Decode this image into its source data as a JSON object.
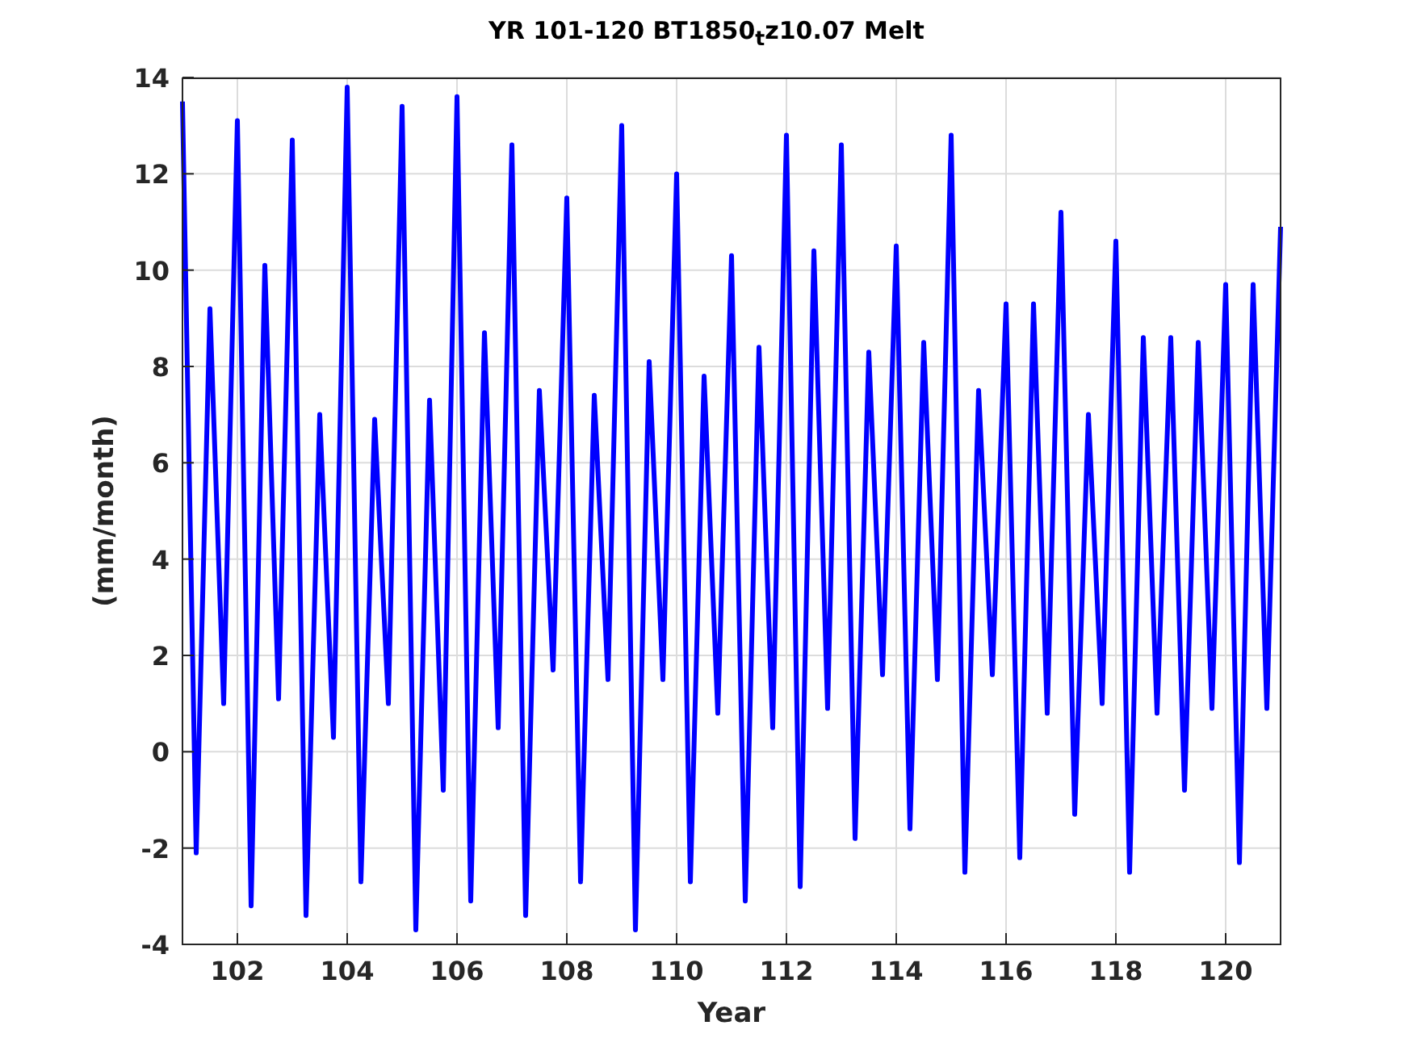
{
  "figure": {
    "chart_data": {
      "type": "line",
      "title": "YR 101-120 BT1850$_{t}$z10.07 Melt",
      "xlabel": "Year",
      "ylabel": "(mm/month)",
      "x": [
        101,
        101.25,
        101.5,
        101.75,
        102,
        102.25,
        102.5,
        102.75,
        103,
        103.25,
        103.5,
        103.75,
        104,
        104.25,
        104.5,
        104.75,
        105,
        105.25,
        105.5,
        105.75,
        106,
        106.25,
        106.5,
        106.75,
        107,
        107.25,
        107.5,
        107.75,
        108,
        108.25,
        108.5,
        108.75,
        109,
        109.25,
        109.5,
        109.75,
        110,
        110.25,
        110.5,
        110.75,
        111,
        111.25,
        111.5,
        111.75,
        112,
        112.25,
        112.5,
        112.75,
        113,
        113.25,
        113.5,
        113.75,
        114,
        114.25,
        114.5,
        114.75,
        115,
        115.25,
        115.5,
        115.75,
        116,
        116.25,
        116.5,
        116.75,
        117,
        117.25,
        117.5,
        117.75,
        118,
        118.25,
        118.5,
        118.75,
        119,
        119.25,
        119.5,
        119.75,
        120,
        120.25,
        120.5,
        120.75,
        121
      ],
      "grid": true,
      "series": [
        {
          "color": "#0000ff",
          "values": [
            13.5,
            -2.1,
            9.2,
            1.0,
            13.1,
            -3.2,
            10.1,
            1.1,
            12.7,
            -3.4,
            7.0,
            0.3,
            13.8,
            -2.7,
            6.9,
            1.0,
            13.4,
            -3.7,
            7.3,
            -0.8,
            13.6,
            -3.1,
            8.7,
            0.5,
            12.6,
            -3.4,
            7.5,
            1.7,
            11.5,
            -2.7,
            7.4,
            1.5,
            13.0,
            -3.7,
            8.1,
            1.5,
            12.0,
            -2.7,
            7.8,
            0.8,
            10.3,
            -3.1,
            8.4,
            0.5,
            12.8,
            -2.8,
            10.4,
            0.9,
            12.6,
            -1.8,
            8.3,
            1.6,
            10.5,
            -1.6,
            8.5,
            1.5,
            12.8,
            -2.5,
            7.5,
            1.6,
            9.3,
            -2.2,
            9.3,
            0.8,
            11.2,
            -1.3,
            7.0,
            1.0,
            10.6,
            -2.5,
            8.6,
            0.8,
            8.6,
            -0.8,
            8.5,
            0.9,
            9.7,
            -2.3,
            9.7,
            0.9,
            10.9
          ]
        }
      ],
      "xlim": [
        101,
        121
      ],
      "ylim": [
        -4,
        14
      ],
      "xticks": [
        102,
        104,
        106,
        108,
        110,
        112,
        114,
        116,
        118,
        120
      ],
      "yticks": [
        -4,
        -2,
        0,
        2,
        4,
        6,
        8,
        10,
        12,
        14
      ]
    }
  }
}
